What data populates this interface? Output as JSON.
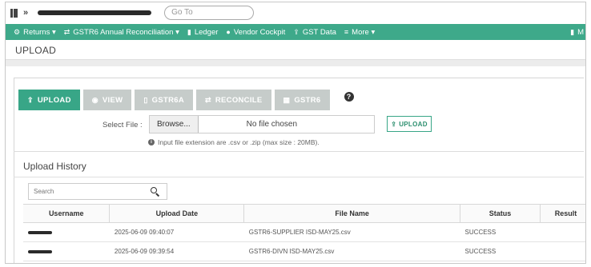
{
  "topbar": {
    "goto_placeholder": "Go To"
  },
  "nav": {
    "items": [
      {
        "icon": "settings-icon",
        "label": "Returns ▾"
      },
      {
        "icon": "exchange-icon",
        "label": "GSTR6 Annual Reconciliation ▾"
      },
      {
        "icon": "ledger-icon",
        "label": "Ledger"
      },
      {
        "icon": "vendor-icon",
        "label": "Vendor Cockpit"
      },
      {
        "icon": "upload-icon",
        "label": "GST Data"
      },
      {
        "icon": "menu-icon",
        "label": "More ▾"
      }
    ],
    "right_label": "M"
  },
  "page": {
    "title": "UPLOAD"
  },
  "tabs": [
    {
      "icon": "upload-icon",
      "label": "UPLOAD",
      "active": true
    },
    {
      "icon": "eye-icon",
      "label": "VIEW",
      "active": false
    },
    {
      "icon": "file-icon",
      "label": "GSTR6A",
      "active": false
    },
    {
      "icon": "exchange-icon",
      "label": "RECONCILE",
      "active": false
    },
    {
      "icon": "grid-icon",
      "label": "GSTR6",
      "active": false
    }
  ],
  "upload_form": {
    "select_file_label": "Select File :",
    "browse_label": "Browse...",
    "no_file_text": "No file chosen",
    "upload_button": "UPLOAD",
    "hint": "Input file extension are .csv or .zip (max size : 20MB)."
  },
  "history": {
    "title": "Upload History",
    "search_placeholder": "Search",
    "columns": [
      "Username",
      "Upload Date",
      "File Name",
      "Status",
      "Result"
    ],
    "rows": [
      {
        "upload_date": "2025-06-09 09:40:07",
        "file_name": "GSTR6-SUPPLIER ISD-MAY25.csv",
        "status": "SUCCESS",
        "result": ""
      },
      {
        "upload_date": "2025-06-09 09:39:54",
        "file_name": "GSTR6-DIVN ISD-MAY25.csv",
        "status": "SUCCESS",
        "result": ""
      }
    ]
  }
}
